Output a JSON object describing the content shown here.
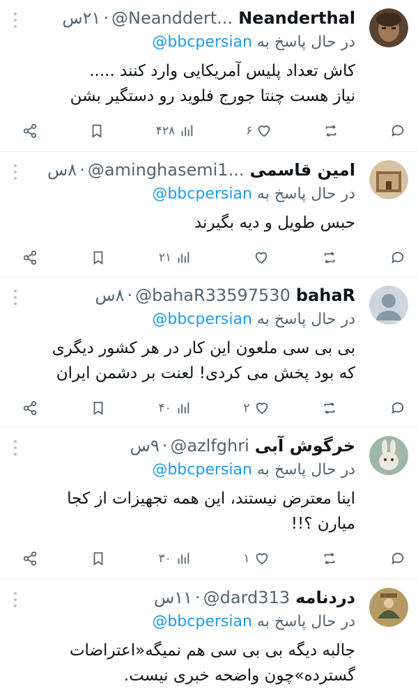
{
  "tweets": [
    {
      "name": "Neanderthal",
      "handle": "@Neanddert...",
      "time": "۲۱س",
      "replying_prefix": "در حال پاسخ به",
      "replying_to": "@bbcpersian",
      "text_lines": [
        "کاش تعداد پلیس آمریکایی وارد کنند .....",
        "نیاز هست چنتا جورج فلوید رو دستگیر بشن"
      ],
      "views": "۴۲۸",
      "likes": "۶",
      "retweets": "",
      "replies": "",
      "avatar_colors": [
        "#8a6a4a",
        "#3d2a1c"
      ]
    },
    {
      "name": "امین قاسمی",
      "handle": "@aminghasemi1...",
      "time": "۸س",
      "replying_prefix": "در حال پاسخ به",
      "replying_to": "@bbcpersian",
      "text_lines": [
        "حبس طویل و دیه بگیرند"
      ],
      "views": "۲۱",
      "likes": "",
      "retweets": "",
      "replies": "",
      "avatar_colors": [
        "#c7a27a",
        "#6b4a2f"
      ]
    },
    {
      "name": "bahaR",
      "handle": "@bahaR33597530",
      "time": "۸س",
      "replying_prefix": "در حال پاسخ به",
      "replying_to": "@bbcpersian",
      "text_lines": [
        "بی بی سی ملعون این کار در هر کشور دیگری",
        "که بود پخش می کردی! لعنت بر دشمن ایران"
      ],
      "views": "۴۰",
      "likes": "۲",
      "retweets": "",
      "replies": "",
      "avatar_colors": [
        "#ccd6dd",
        "#8899a6"
      ]
    },
    {
      "name": "خرگوش آبی",
      "handle": "@azlfghri",
      "time": "۹س",
      "replying_prefix": "در حال پاسخ به",
      "replying_to": "@bbcpersian",
      "text_lines": [
        "اینا معترض نیستند، این همه تجهیزات از کجا",
        "میارن ؟!!"
      ],
      "views": "۳۰",
      "likes": "۱",
      "retweets": "",
      "replies": "",
      "avatar_colors": [
        "#9fb7a8",
        "#e9e3d6"
      ]
    },
    {
      "name": "دردنامه",
      "handle": "@dard313",
      "time": "۱۱س",
      "replying_prefix": "در حال پاسخ به",
      "replying_to": "@bbcpersian",
      "text_lines": [
        "جالبه دیگه بی بی سی هم نمیگه«اعتراضات",
        "گسترده»چون واضحه خبری نیست."
      ],
      "views": "",
      "likes": "",
      "retweets": "",
      "replies": "",
      "avatar_colors": [
        "#b59b63",
        "#4f5a3c"
      ]
    }
  ],
  "colors": {
    "text": "#0f1419",
    "secondary": "#536471",
    "accent": "#1d9bf0",
    "divider": "#e6ecf0"
  },
  "icons": {
    "reply": "speech-bubble-icon",
    "retweet": "retweet-arrows-icon",
    "like": "heart-icon",
    "views": "bar-chart-icon",
    "bookmark": "bookmark-icon",
    "share": "share-nodes-icon",
    "more": "vertical-dots-icon"
  }
}
